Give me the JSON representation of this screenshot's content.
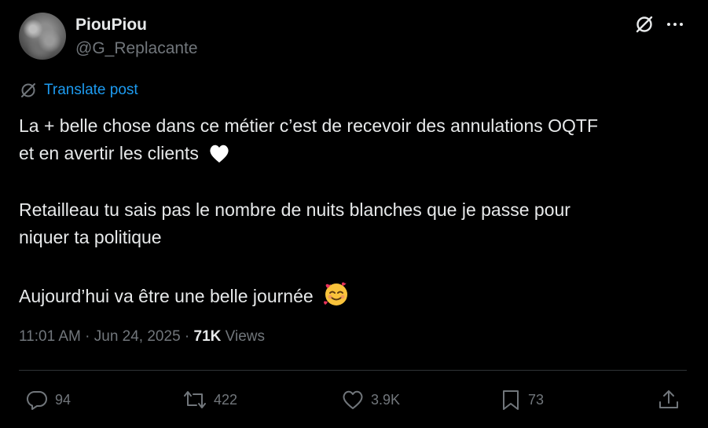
{
  "author": {
    "name": "PiouPiou",
    "handle": "@G_Replacante"
  },
  "translate_label": "Translate post",
  "body_lines": [
    "La + belle chose dans ce métier c’est de recevoir des annulations OQTF",
    "et en avertir les clients",
    "Retailleau tu sais pas le nombre de nuits blanches que je passe pour",
    "niquer ta politique",
    "Aujourd’hui va être une belle journée"
  ],
  "emojis": [
    "white-heart",
    "smiling-face-with-hearts"
  ],
  "meta": {
    "time": "11:01 AM",
    "sep1": "·",
    "date": "Jun 24, 2025",
    "sep2": "·",
    "views_count": "71K",
    "views_label": "Views"
  },
  "actions": {
    "replies": "94",
    "reposts": "422",
    "likes": "3.9K",
    "bookmarks": "73"
  },
  "colors": {
    "background": "#000000",
    "text": "#e7e9ea",
    "muted": "#71767b",
    "link": "#1d9bf0",
    "divider": "#2f3336"
  }
}
